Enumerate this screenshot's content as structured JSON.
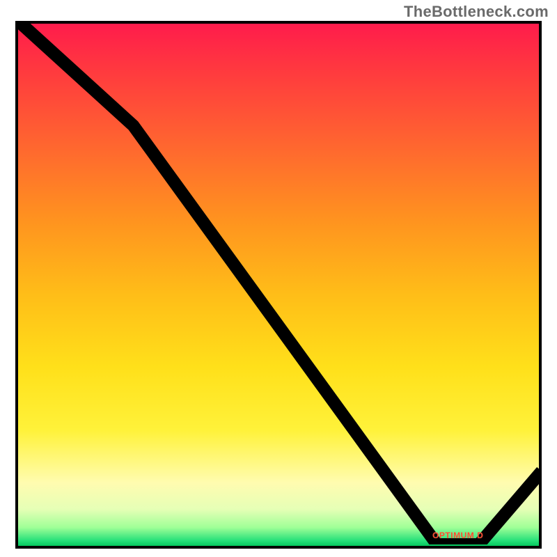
{
  "attribution": "TheBottleneck.com",
  "min_label": "OPTIMUM D",
  "gradient_stops": [
    {
      "pct": 0,
      "color": "#ff1a4c"
    },
    {
      "pct": 10,
      "color": "#ff3b3e"
    },
    {
      "pct": 25,
      "color": "#ff6a2e"
    },
    {
      "pct": 38,
      "color": "#ff931f"
    },
    {
      "pct": 52,
      "color": "#ffbd18"
    },
    {
      "pct": 66,
      "color": "#ffe01a"
    },
    {
      "pct": 78,
      "color": "#fff23a"
    },
    {
      "pct": 88,
      "color": "#fffcb0"
    },
    {
      "pct": 93,
      "color": "#e6ffb6"
    },
    {
      "pct": 96.5,
      "color": "#9fff97"
    },
    {
      "pct": 99,
      "color": "#26e07a"
    },
    {
      "pct": 100,
      "color": "#06c85f"
    }
  ],
  "chart_data": {
    "type": "line",
    "title": "",
    "xlabel": "",
    "ylabel": "",
    "xlim": [
      0,
      100
    ],
    "ylim": [
      0,
      100
    ],
    "series": [
      {
        "name": "bottleneck-curve",
        "x": [
          0,
          22,
          80,
          88,
          100
        ],
        "y": [
          100,
          80,
          0,
          0,
          14
        ]
      }
    ],
    "minimum_region": {
      "x_start": 80,
      "x_end": 88,
      "label": "OPTIMUM D"
    }
  }
}
